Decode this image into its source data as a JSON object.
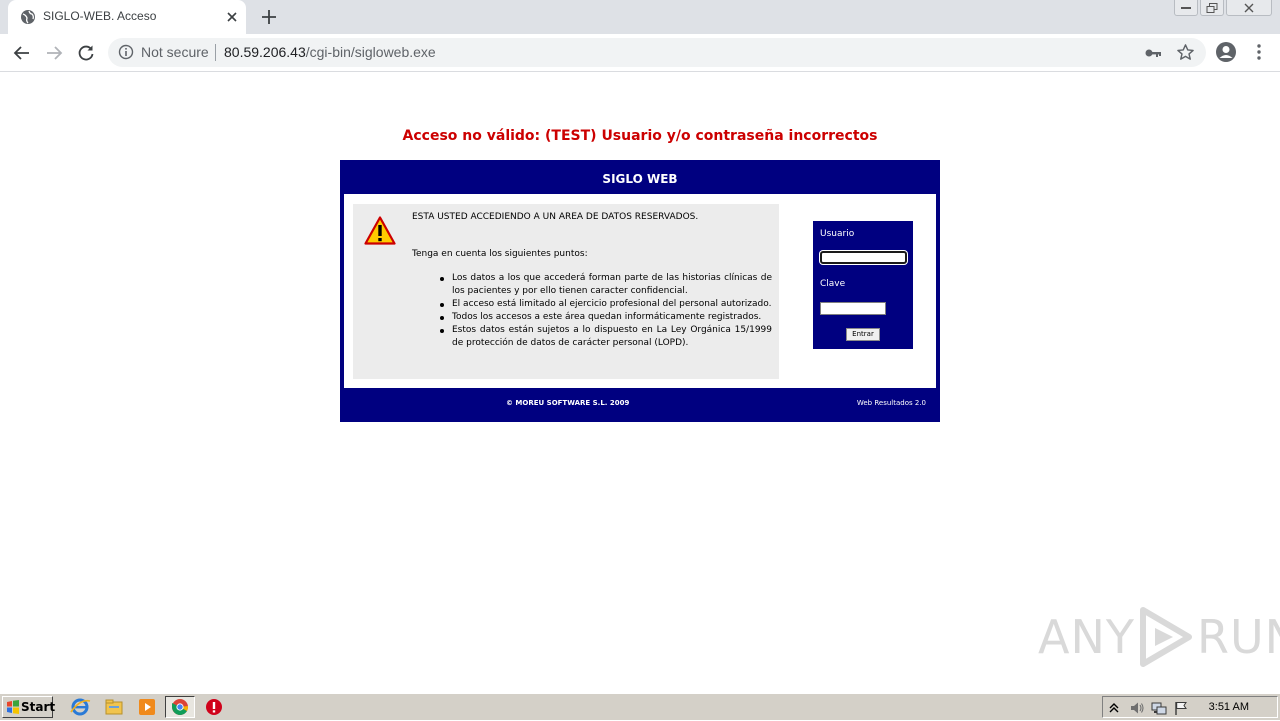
{
  "browser": {
    "tab_title": "SIGLO-WEB. Acceso",
    "security_label": "Not secure",
    "url_host": "80.59.206.43",
    "url_path": "/cgi-bin/sigloweb.exe"
  },
  "page": {
    "error_message": "Acceso no válido: (TEST) Usuario y/o contraseña incorrectos",
    "panel_title": "SIGLO WEB",
    "notice_heading": "ESTA USTED ACCEDIENDO A UN AREA DE DATOS RESERVADOS.",
    "notice_intro": "Tenga en cuenta los siguientes puntos:",
    "notice_points": [
      "Los datos a los que accederá forman parte de las historias clínicas de los pacientes y por ello tienen caracter confidencial.",
      "El acceso está limitado al ejercicio profesional del personal autorizado.",
      "Todos los accesos a este área quedan informáticamente registrados.",
      "Estos datos están sujetos a lo dispuesto en La Ley Orgánica 15/1999 de protección de datos de carácter personal (LOPD)."
    ],
    "login": {
      "user_label": "Usuario",
      "user_value": "",
      "password_label": "Clave",
      "password_value": "",
      "submit_label": "Entrar"
    },
    "footer_left": "© MOREU SOFTWARE S.L. 2009",
    "footer_right": "Web Resultados 2.0"
  },
  "watermark": {
    "left": "ANY",
    "right": "RUN"
  },
  "taskbar": {
    "start_label": "Start",
    "clock": "3:51 AM"
  },
  "colors": {
    "panel_navy": "#000080",
    "error_red": "#cc0000",
    "notice_bg": "#ececec"
  }
}
